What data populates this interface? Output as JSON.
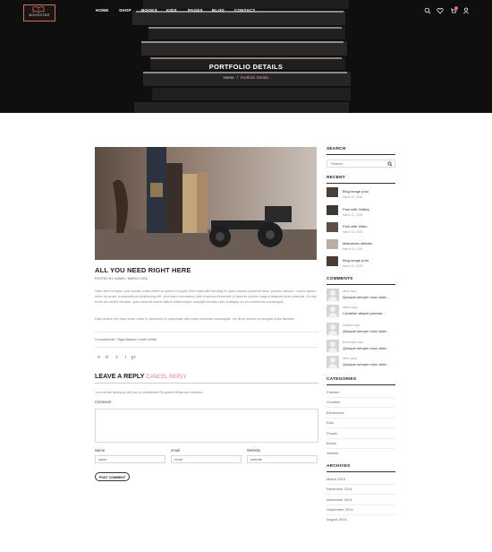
{
  "header": {
    "logo_text": "BOOKSTAR",
    "nav": [
      "HOME",
      "SHOP",
      "BOOKS",
      "KIDS",
      "PAGES",
      "BLOG",
      "CONTACT"
    ],
    "icons": [
      "search-icon",
      "heart-icon",
      "cart-icon",
      "user-icon"
    ],
    "cart_count": "0"
  },
  "hero": {
    "title": "PORTFOLIO DETAILS",
    "breadcrumb": [
      "Home",
      "/",
      "Portfolio Details"
    ]
  },
  "post": {
    "title": "ALL YOU NEED RIGHT HERE",
    "meta": "POSTED BY: ADMIN / MARCH 2015",
    "paragraph1": "Nam liber tempor cum soluta nobis eleifend option congue nihil imperdiet doming id quod mazim placerat facer possim assum. Lorem ipsum dolor sit amet, consectetuer adipiscing elit, sed diam nonummy nibh euismod tincidunt ut laoreet dolore magna aliquam erat volutpat. Ut wisi enim ad minim veniam, quis nostrud exerci tation ullamcorper suscipit lobortis nisl ut aliquip ex ea commodo consequat.",
    "paragraph2": "Duis autem vel eum iriure dolor in hendrerit in vulputate velit esse molestie consequat, vel illum dolore eu feugiat nulla facilisis.",
    "tags": "3 comments / Tags:fashion t-shirt white",
    "share_icons": [
      "rss-icon",
      "linkedin-icon",
      "vimeo-icon",
      "tumblr-icon",
      "google-plus-icon"
    ]
  },
  "reply": {
    "title": "LEAVE A REPLY",
    "cancel": "CANCEL REPLY",
    "note": "Your email address will not be published.Required fields are marked",
    "comment_label": "Comment",
    "name_label": "Name",
    "email_label": "email",
    "website_label": "Website",
    "name_placeholder": "name",
    "email_placeholder": "email",
    "website_placeholder": "website",
    "submit": "POST COMMENT"
  },
  "sidebar": {
    "search_heading": "SEARCH",
    "search_placeholder": "Search...",
    "recent_heading": "RECENT",
    "recent": [
      {
        "title": "Blog image post",
        "date": "March 10, 2015"
      },
      {
        "title": "Post with Gallery",
        "date": "March 10, 2015"
      },
      {
        "title": "Post with Video",
        "date": "March 10, 2015"
      },
      {
        "title": "Maecenas ultricies",
        "date": "March 10, 2015"
      },
      {
        "title": "Blog image post",
        "date": "March 10, 2015"
      }
    ],
    "comments_heading": "COMMENTS",
    "comments": [
      {
        "author": "demo says:",
        "text": "Quisque semper nunc vitae..."
      },
      {
        "author": "admin says:",
        "text": "Curabitur aliquet pulvinar..."
      },
      {
        "author": "Hastech says:",
        "text": "Quisque semper nunc vitae..."
      },
      {
        "author": "Bootexpert says:",
        "text": "Quisque semper nunc vitae..."
      },
      {
        "author": "demo says:",
        "text": "Quisque semper nunc vitae..."
      }
    ],
    "categories_heading": "CATEGORIES",
    "categories": [
      "Fashion",
      "Creative",
      "Electronics",
      "Kids",
      "Flower",
      "Books",
      "Jewelle"
    ],
    "archives_heading": "ARCHIVES",
    "archives": [
      "March 2015",
      "December 2014",
      "November 2014",
      "September 2014",
      "August 2014"
    ]
  }
}
